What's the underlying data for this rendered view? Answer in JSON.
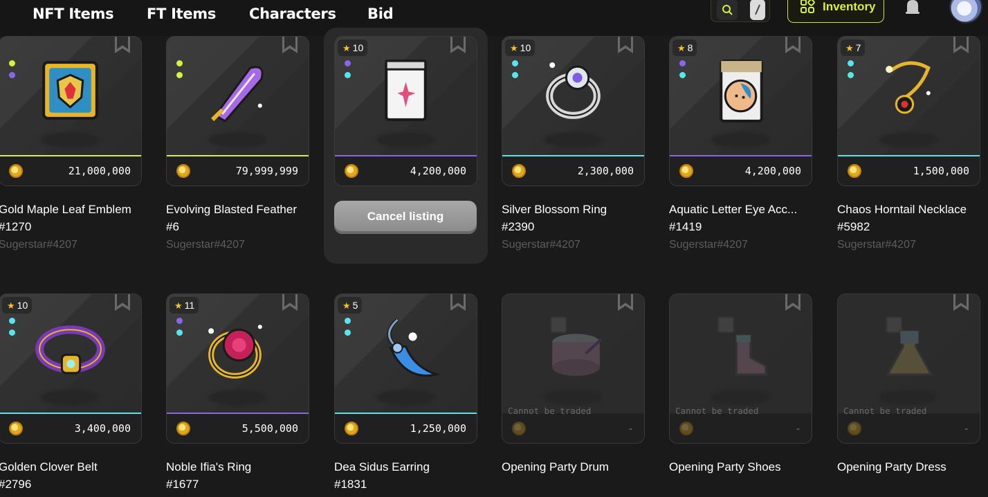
{
  "nav": {
    "items": [
      {
        "label": "NFT Items"
      },
      {
        "label": "FT Items"
      },
      {
        "label": "Characters"
      },
      {
        "label": "Bid"
      }
    ],
    "inventory_label": "Inventory"
  },
  "colors": {
    "accent": "#d6f23a",
    "background": "#1a1a1a",
    "dot_purple": "#8a66ee",
    "dot_cyan": "#55e6ee",
    "dot_yellow": "#d7f23a",
    "coin": "#f2b92a"
  },
  "cancel_label": "Cancel listing",
  "untradeable_label": "Cannot be traded",
  "items": [
    {
      "name": "Gold Maple Leaf Emblem",
      "serial": "#1270",
      "owner": "Sugerstar#4207",
      "price": "21,000,000",
      "stars": "",
      "dots": [
        "dot_yellow",
        "dot_purple"
      ],
      "accent": "dot_yellow",
      "icon": "emblem-icon"
    },
    {
      "name": "Evolving Blasted Feather",
      "serial": "#6",
      "owner": "Sugerstar#4207",
      "price": "79,999,999",
      "stars": "",
      "dots": [
        "dot_yellow",
        "dot_yellow"
      ],
      "accent": "dot_yellow",
      "icon": "feather-icon"
    },
    {
      "name": "",
      "serial": "",
      "owner": "",
      "price": "4,200,000",
      "stars": "10",
      "dots": [
        "dot_purple",
        "dot_cyan"
      ],
      "accent": "dot_purple",
      "icon": "scroll-icon"
    },
    {
      "name": "Silver Blossom Ring",
      "serial": "#2390",
      "owner": "Sugerstar#4207",
      "price": "2,300,000",
      "stars": "10",
      "dots": [
        "dot_cyan",
        "dot_cyan"
      ],
      "accent": "dot_cyan",
      "icon": "ring-icon"
    },
    {
      "name": "Aquatic Letter Eye Acc...",
      "serial": "#1419",
      "owner": "Sugerstar#4207",
      "price": "4,200,000",
      "stars": "8",
      "dots": [
        "dot_purple",
        "dot_cyan"
      ],
      "accent": "dot_purple",
      "icon": "eye-accessory-icon"
    },
    {
      "name": "Chaos Horntail Necklace",
      "serial": "#5982",
      "owner": "Sugerstar#4207",
      "price": "1,500,000",
      "stars": "7",
      "dots": [
        "dot_cyan",
        "dot_cyan"
      ],
      "accent": "dot_cyan",
      "icon": "necklace-icon"
    },
    {
      "name": "Golden Clover Belt",
      "serial": "#2796",
      "owner": "",
      "price": "3,400,000",
      "stars": "10",
      "dots": [
        "dot_cyan",
        "dot_cyan"
      ],
      "accent": "dot_cyan",
      "icon": "belt-icon"
    },
    {
      "name": "Noble Ifia's Ring",
      "serial": "#1677",
      "owner": "",
      "price": "5,500,000",
      "stars": "11",
      "dots": [
        "dot_purple",
        "dot_cyan"
      ],
      "accent": "dot_purple",
      "icon": "rose-ring-icon"
    },
    {
      "name": "Dea Sidus Earring",
      "serial": "#1831",
      "owner": "",
      "price": "1,250,000",
      "stars": "5",
      "dots": [
        "dot_cyan",
        "dot_cyan"
      ],
      "accent": "dot_cyan",
      "icon": "earring-icon"
    },
    {
      "name": "Opening Party Drum",
      "serial": "",
      "owner": "",
      "price": "-",
      "stars": "",
      "dots": [],
      "accent": "",
      "icon": "drum-icon"
    },
    {
      "name": "Opening Party Shoes",
      "serial": "",
      "owner": "",
      "price": "-",
      "stars": "",
      "dots": [],
      "accent": "",
      "icon": "shoes-icon"
    },
    {
      "name": "Opening Party Dress",
      "serial": "",
      "owner": "",
      "price": "-",
      "stars": "",
      "dots": [],
      "accent": "",
      "icon": "dress-icon"
    }
  ]
}
